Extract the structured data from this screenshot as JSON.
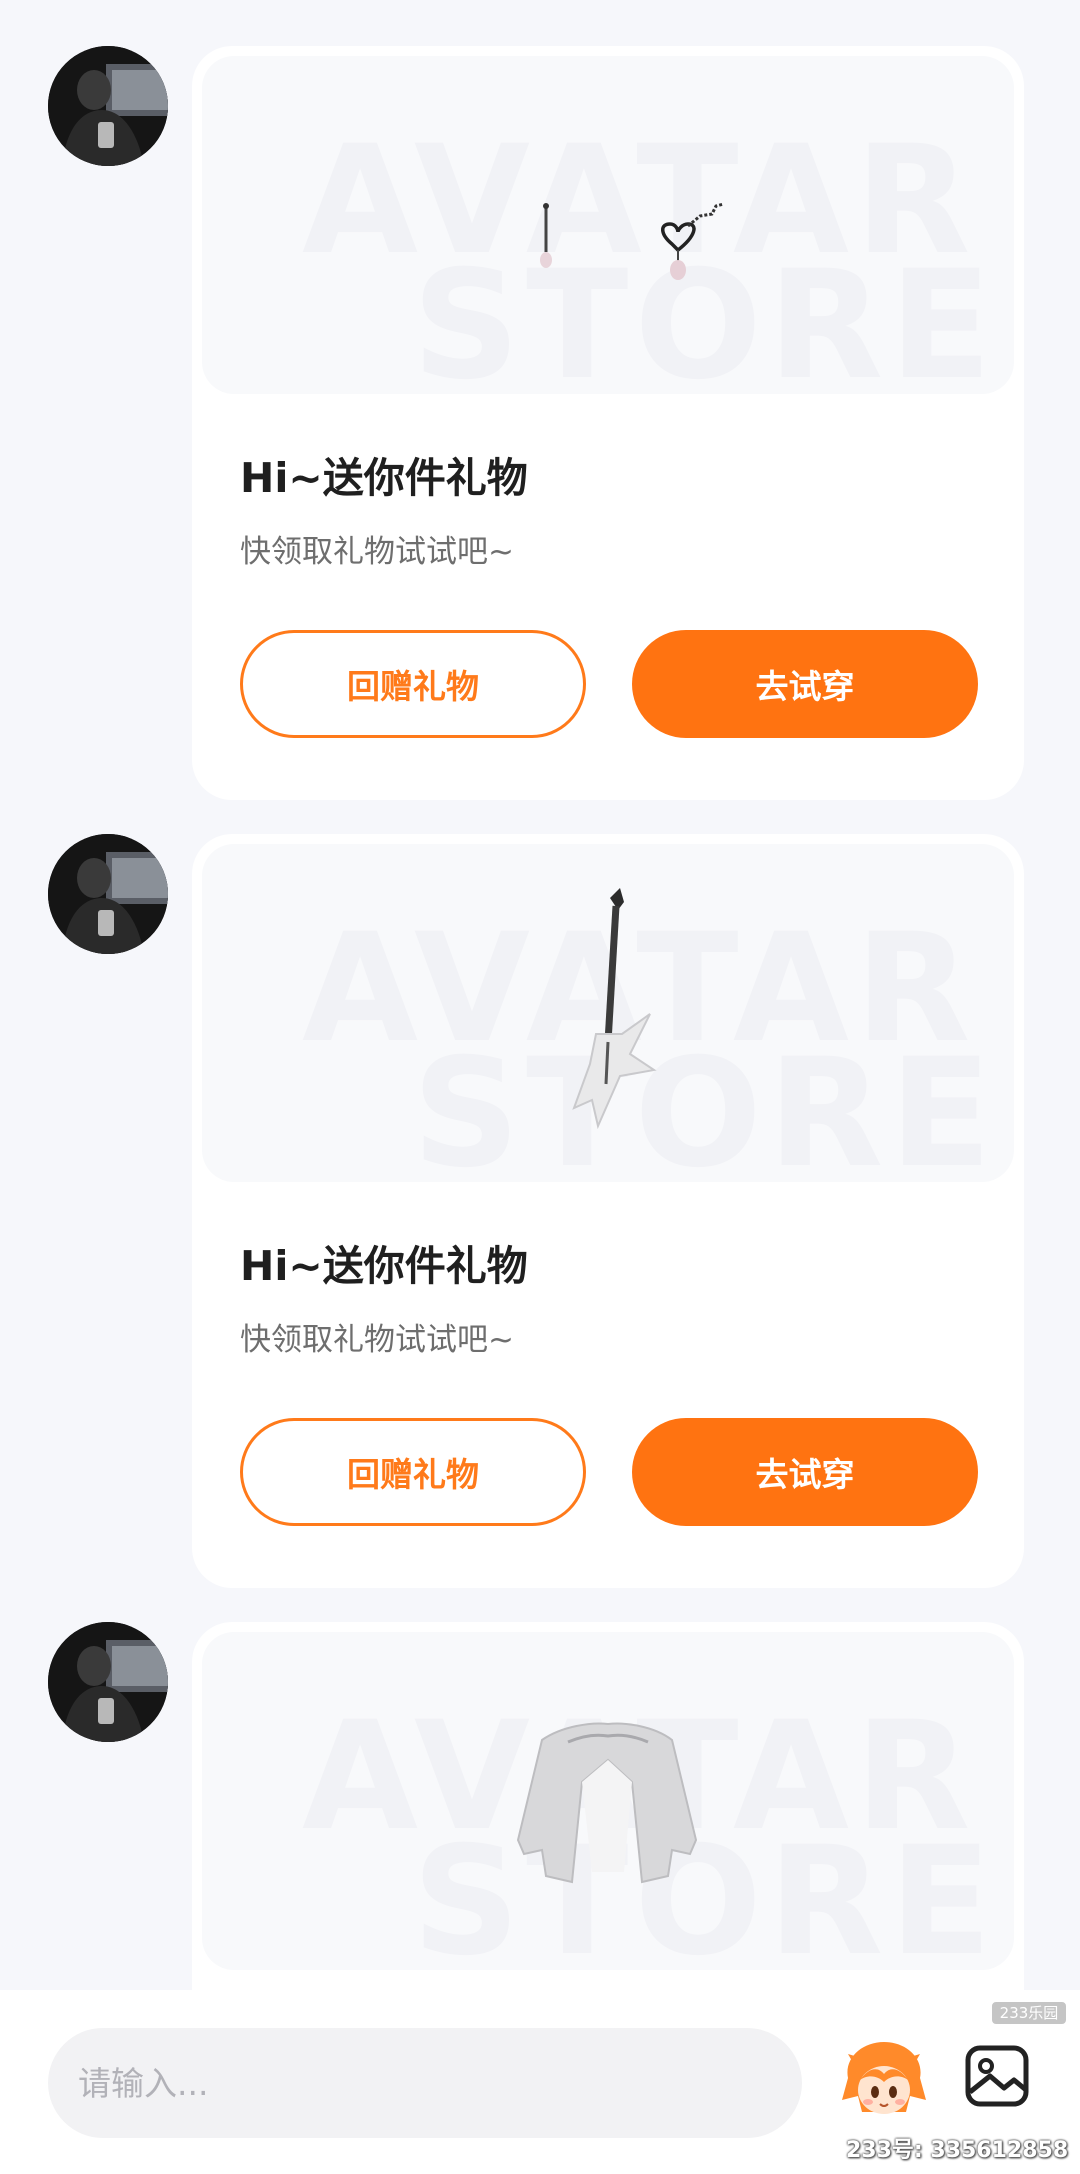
{
  "messages": [
    {
      "avatar_icon": "user-avatar",
      "item_icon": "heart-earrings-icon",
      "watermark_line1": "AVATAR",
      "watermark_line2": "STORE",
      "title": "Hi~送你件礼物",
      "subtitle": "快领取礼物试试吧~",
      "return_gift_label": "回赠礼物",
      "try_on_label": "去试穿"
    },
    {
      "avatar_icon": "user-avatar",
      "item_icon": "guitar-icon",
      "watermark_line1": "AVATAR",
      "watermark_line2": "STORE",
      "title": "Hi~送你件礼物",
      "subtitle": "快领取礼物试试吧~",
      "return_gift_label": "回赠礼物",
      "try_on_label": "去试穿"
    },
    {
      "avatar_icon": "user-avatar",
      "item_icon": "jacket-icon",
      "watermark_line1": "AVATAR",
      "watermark_line2": "STORE"
    }
  ],
  "input_bar": {
    "placeholder": "请输入...",
    "mascot_icon": "mascot-emoji-icon",
    "image_icon": "image-icon"
  },
  "overlay": {
    "logo_text": "233乐园",
    "uid_text": "233号: 335612858"
  },
  "colors": {
    "accent": "#ff7311",
    "background": "#f6f7fb",
    "card": "#ffffff"
  }
}
